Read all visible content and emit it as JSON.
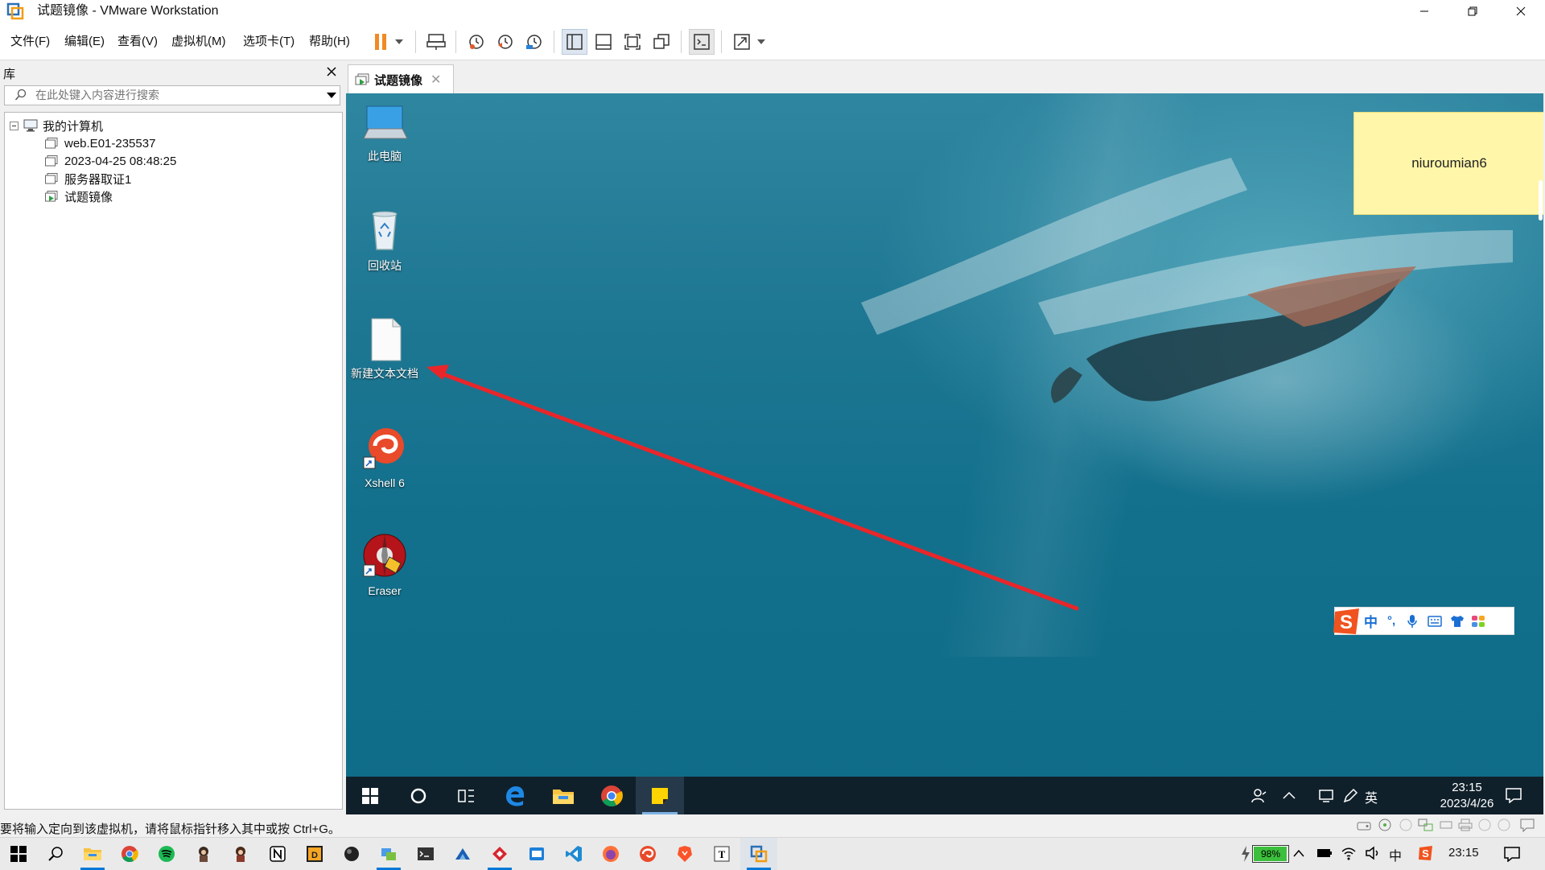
{
  "window": {
    "title": "试题镜像 - VMware Workstation"
  },
  "menu": [
    "文件(F)",
    "编辑(E)",
    "查看(V)",
    "虚拟机(M)",
    "选项卡(T)",
    "帮助(H)"
  ],
  "library": {
    "title": "库",
    "search_placeholder": "在此处键入内容进行搜索",
    "root": "我的计算机",
    "items": [
      "web.E01-235537",
      "2023-04-25 08:48:25",
      "服务器取证1",
      "试题镜像"
    ]
  },
  "vm_tab": {
    "label": "试题镜像"
  },
  "desktop": {
    "icons": [
      "此电脑",
      "回收站",
      "新建文本文档",
      "Xshell 6",
      "Eraser"
    ],
    "sticky_note": "niuroumian6",
    "ime": [
      "中",
      "°,"
    ]
  },
  "guest_taskbar": {
    "time": "23:15",
    "date": "2023/4/26",
    "ime_lang": "英"
  },
  "statusbar": {
    "text": "要将输入定向到该虚拟机，请将鼠标指针移入其中或按 Ctrl+G。"
  },
  "host_taskbar": {
    "battery": "98%",
    "time": "23:15",
    "ime_lang": "中"
  },
  "colors": {
    "accent": "#0078d7",
    "annotation_arrow": "#e8262a",
    "sticky": "#fff6a9",
    "pause_orange": "#f08a24"
  }
}
